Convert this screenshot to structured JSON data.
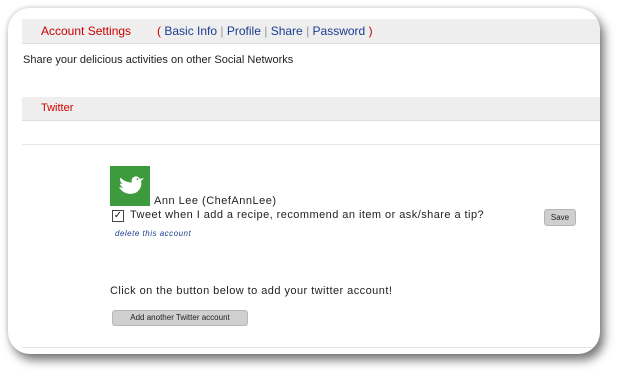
{
  "header": {
    "title": "Account Settings",
    "open_paren": "(",
    "close_paren": ")",
    "separator": "|",
    "links": [
      "Basic Info",
      "Profile",
      "Share",
      "Password"
    ]
  },
  "intro_text": "Share your delicious activities on other Social Networks",
  "section": {
    "title": "Twitter"
  },
  "account": {
    "avatar_icon": "twitter-bird-icon",
    "name": "Ann Lee (ChefAnnLee)",
    "tweet_option_checked": true,
    "checkbox_mark": "✓",
    "tweet_option_label": "Tweet when I add a recipe, recommend an item or ask/share a tip?",
    "save_label": "Save",
    "delete_label": "delete this account"
  },
  "add_account": {
    "prompt": "Click on the button below to add your twitter account!",
    "button_label": "Add another Twitter account"
  },
  "colors": {
    "accent_red": "#cc0000",
    "link_blue": "#1a3d8f",
    "avatar_green": "#3d9a3d",
    "bar_gray": "#eeeeee"
  }
}
